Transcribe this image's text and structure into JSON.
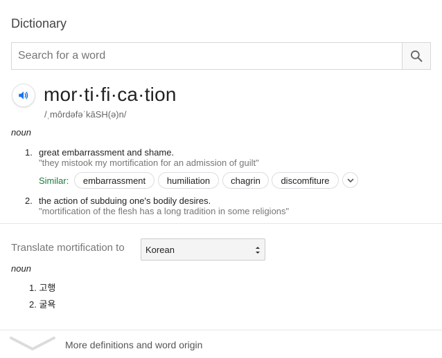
{
  "header": {
    "title": "Dictionary"
  },
  "search": {
    "placeholder": "Search for a word",
    "button_icon": "search-icon"
  },
  "entry": {
    "word": "mor·ti·fi·ca·tion",
    "phonetic": "/ˌmôrdəfəˈkāSH(ə)n/",
    "part_of_speech": "noun",
    "definitions": [
      {
        "number": "1.",
        "text": "great embarrassment and shame.",
        "example": "\"they mistook my mortification for an admission of guilt\""
      },
      {
        "number": "2.",
        "text": "the action of subduing one's bodily desires.",
        "example": "\"mortification of the flesh has a long tradition in some religions\""
      }
    ],
    "similar": {
      "label": "Similar:",
      "words": [
        "embarrassment",
        "humiliation",
        "chagrin",
        "discomfiture"
      ]
    }
  },
  "translate": {
    "label": "Translate mortification to",
    "selected_language": "Korean",
    "part_of_speech": "noun",
    "items": [
      "1. 고행",
      "2. 굴욕"
    ]
  },
  "footer": {
    "more_label": "More definitions and word origin"
  },
  "colors": {
    "similar_label": "#1a7c3c",
    "speaker_icon": "#1a73e8"
  }
}
